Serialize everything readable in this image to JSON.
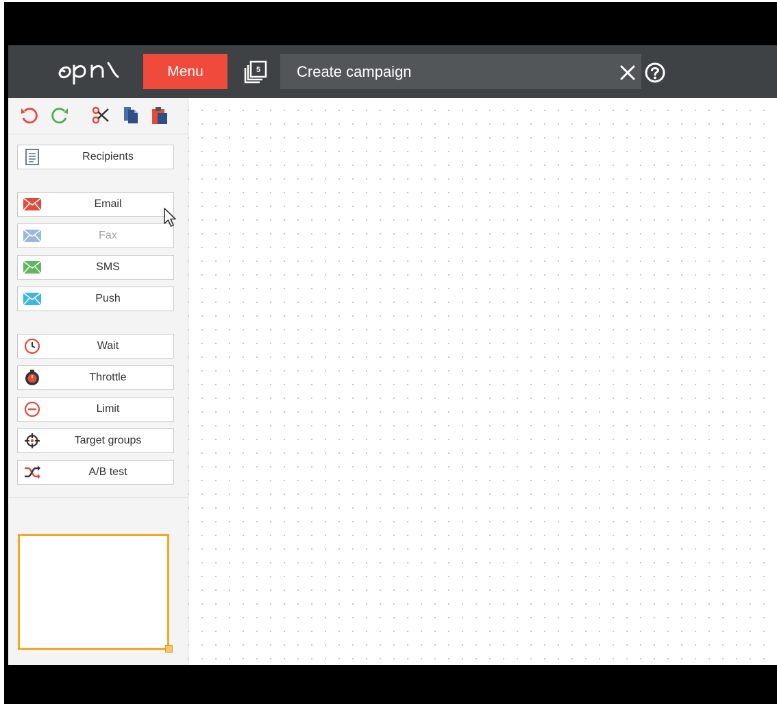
{
  "topbar": {
    "menu_label": "Menu",
    "tab_count": "5",
    "title": "Create campaign"
  },
  "toolbar": {
    "icons": [
      "undo-icon",
      "redo-icon",
      "cut-icon",
      "copy-icon",
      "paste-icon"
    ]
  },
  "palette": {
    "recipients": "Recipients",
    "email": "Email",
    "fax": "Fax",
    "sms": "SMS",
    "push": "Push",
    "wait": "Wait",
    "throttle": "Throttle",
    "limit": "Limit",
    "target_groups": "Target groups",
    "ab_test": "A/B test"
  },
  "zoom": {
    "icons": [
      "zoom-in-icon",
      "zoom-out-icon",
      "zoom-reset-icon",
      "zoom-fit-icon"
    ]
  },
  "colors": {
    "topbar": "#3f4244",
    "menu_button": "#ef4a3c",
    "title_field": "#535658",
    "minimap_border": "#f5a623",
    "email_icon": "#e24a3b",
    "fax_icon": "#9bb7dd",
    "sms_icon": "#5cb85c",
    "push_icon": "#3bb7e0",
    "accent_red": "#e24a3b"
  }
}
